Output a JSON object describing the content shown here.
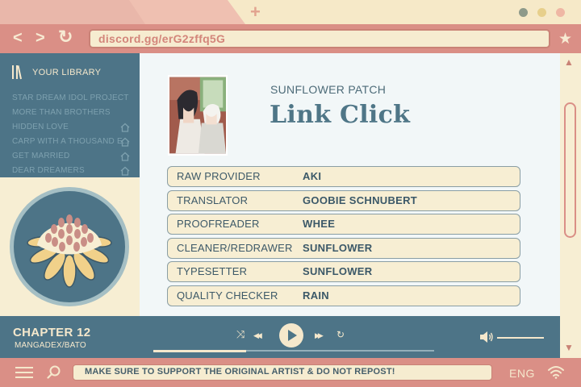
{
  "browser": {
    "new_tab_symbol": "+",
    "url": "discord.gg/erG2zffq5G",
    "nav": {
      "back": "<",
      "forward": ">",
      "reload": "↻",
      "bookmark": "★"
    }
  },
  "library": {
    "title": "YOUR LIBRARY",
    "items": [
      {
        "label": "STAR DREAM IDOL PROJECT",
        "home": false
      },
      {
        "label": "MORE THAN BROTHERS",
        "home": false
      },
      {
        "label": "HIDDEN LOVE",
        "home": true
      },
      {
        "label": "CARP WITH A THOUSAND E...",
        "home": true
      },
      {
        "label": "GET MARRIED",
        "home": true
      },
      {
        "label": "DEAR DREAMERS",
        "home": true
      }
    ]
  },
  "series": {
    "group": "SUNFLOWER PATCH",
    "title": "Link Click"
  },
  "credits": [
    {
      "role": "RAW PROVIDER",
      "name": "AKI"
    },
    {
      "role": "TRANSLATOR",
      "name": "GOOBIE SCHNUBERT"
    },
    {
      "role": "PROOFREADER",
      "name": "WHEE"
    },
    {
      "role": "CLEANER/REDRAWER",
      "name": "SUNFLOWER"
    },
    {
      "role": "TYPESETTER",
      "name": "SUNFLOWER"
    },
    {
      "role": "QUALITY CHECKER",
      "name": "RAIN"
    }
  ],
  "player": {
    "chapter": "CHAPTER 12",
    "source": "MANGADEX/BATO",
    "controls": {
      "shuffle": "⤨",
      "prev": "◀◀",
      "next": "▶▶",
      "repeat": "↻"
    },
    "progress": 0.33
  },
  "footer": {
    "notice": "MAKE SURE TO SUPPORT THE ORIGINAL ARTIST & DO NOT REPOST!",
    "language": "ENG"
  },
  "colors": {
    "frame": "#da8f86",
    "panel": "#4d7487",
    "cream": "#f7eed3",
    "accent_text": "#4f7687"
  }
}
